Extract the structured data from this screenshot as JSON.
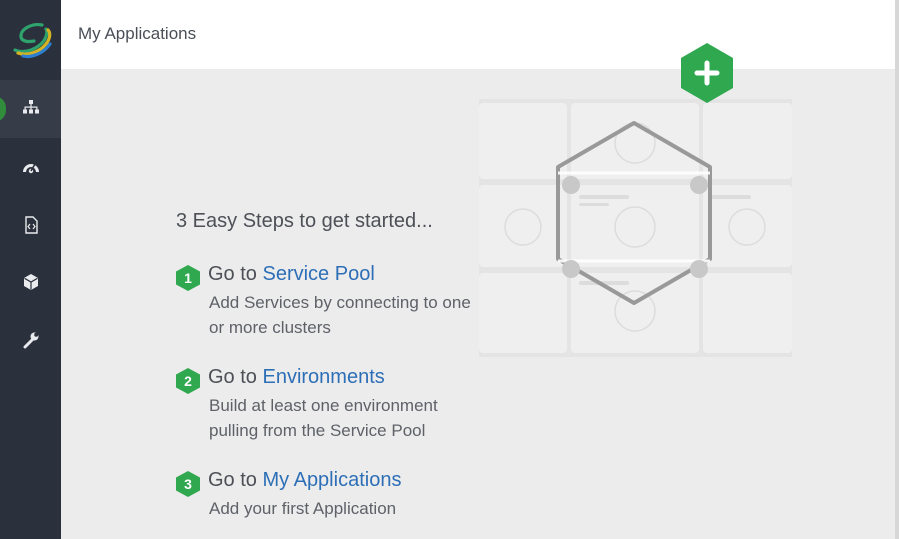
{
  "app": {
    "logo": "app-logo"
  },
  "header": {
    "title": "My Applications"
  },
  "sidebar": {
    "items": [
      {
        "id": "applications",
        "icon": "sitemap-icon",
        "active": true
      },
      {
        "id": "dashboard",
        "icon": "dashboard-icon",
        "active": false
      },
      {
        "id": "templates",
        "icon": "code-file-icon",
        "active": false
      },
      {
        "id": "service-pool",
        "icon": "cube-icon",
        "active": false
      },
      {
        "id": "tools",
        "icon": "wrench-icon",
        "active": false
      }
    ]
  },
  "main": {
    "add_button_icon": "plus-icon",
    "steps_title": "3 Easy Steps to get started...",
    "steps": [
      {
        "number": "1",
        "prefix": "Go to ",
        "link": "Service Pool",
        "description": "Add Services by connecting to one or more clusters"
      },
      {
        "number": "2",
        "prefix": "Go to ",
        "link": "Environments",
        "description": "Build at least one environment pulling from the Service Pool"
      },
      {
        "number": "3",
        "prefix": "Go to ",
        "link": "My Applications",
        "description": "Add your first Application"
      }
    ]
  },
  "colors": {
    "accent_green": "#2fa84f",
    "link_blue": "#2d6fb7",
    "sidebar_bg": "#2b313c"
  }
}
